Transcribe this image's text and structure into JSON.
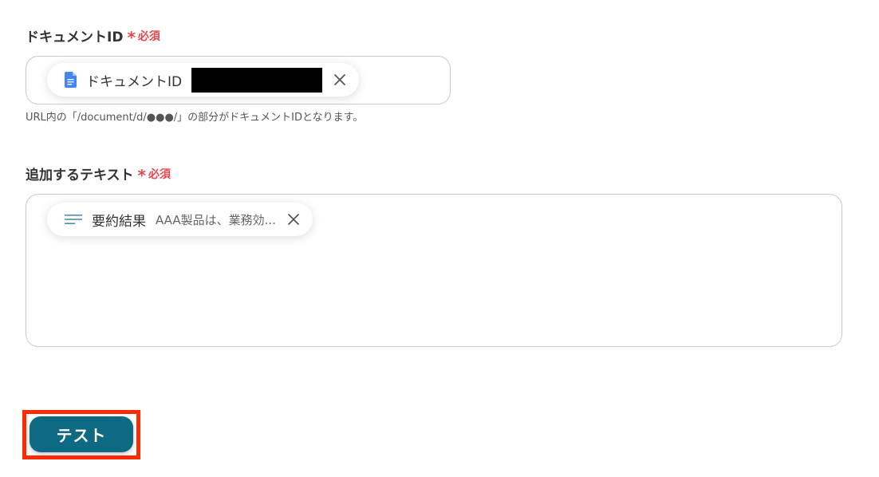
{
  "fields": {
    "document_id": {
      "label": "ドキュメントID",
      "required_star": "*",
      "required_text": "必須",
      "chip": {
        "icon": "google-docs-icon",
        "label": "ドキュメントID",
        "value_redacted": true
      },
      "help_text": "URL内の「/document/d/●●●/」の部分がドキュメントIDとなります。"
    },
    "append_text": {
      "label": "追加するテキスト",
      "required_star": "*",
      "required_text": "必須",
      "chip": {
        "icon": "text-lines-icon",
        "label": "要約結果",
        "value": "AAA製品は、業務効..."
      }
    }
  },
  "actions": {
    "test_button_label": "テスト"
  },
  "colors": {
    "required": "#e5484d",
    "primary_button": "#0e6a83",
    "highlight": "#ff2a00",
    "docs_icon": "#4285f4"
  }
}
